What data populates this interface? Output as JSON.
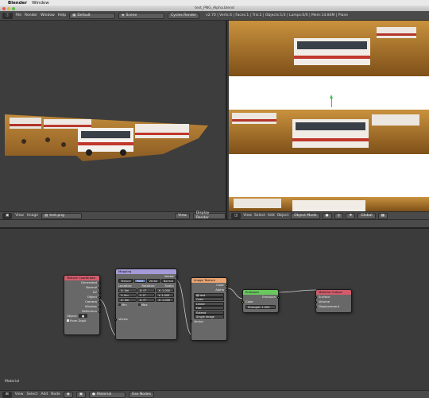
{
  "mac_menubar": {
    "app": "Blender",
    "window": "Window"
  },
  "window_title": "test_PNG_Alpha.blend",
  "info_header": {
    "menus": [
      "File",
      "Render",
      "Window",
      "Help"
    ],
    "layout": "Default",
    "scene": "Scene",
    "engine": "Cycles Render",
    "stats": "v2.70 | Verts:4 | Faces:1 | Tris:2 | Objects:1/3 | Lamps:0/0 | Mem:14.84M | Plane"
  },
  "view3d_header": {
    "menus": [
      "View",
      "Image"
    ],
    "image_name": "test.png",
    "view_label": "View",
    "mode": "Display Render"
  },
  "image_header": {
    "menus": [
      "View",
      "Select",
      "Add",
      "Object"
    ],
    "mode": "Object Mode",
    "orientation": "Global"
  },
  "node_editor": {
    "label": "Material",
    "header": {
      "menus": [
        "View",
        "Select",
        "Add",
        "Node"
      ],
      "material": "Material",
      "use_nodes": "Use Nodes"
    },
    "texcoord": {
      "title": "Texture Coordinate",
      "outputs": [
        "Generated",
        "Normal",
        "UV",
        "Object",
        "Camera",
        "Window",
        "Reflection"
      ],
      "object_label": "Object:",
      "from_dupli": "From Dupli"
    },
    "mapping": {
      "title": "Mapping",
      "vector_out": "Vector",
      "tabs": [
        "Texture",
        "Point",
        "Vector",
        "Normal"
      ],
      "cols": [
        "Location:",
        "Rotation:",
        "Scale:"
      ],
      "rows": [
        [
          "X: 0m",
          "X: 0°",
          "X: 1.000"
        ],
        [
          "Y: 0m",
          "Y: 0°",
          "Y: 1.000"
        ],
        [
          "Z: 0m",
          "Z: 0°",
          "Z: 1.000"
        ]
      ],
      "min": "Min",
      "max": "Max",
      "vector_in": "Vector"
    },
    "image_tex": {
      "title": "Image Texture",
      "outputs": [
        "Color",
        "Alpha"
      ],
      "image": "test",
      "options": [
        "Color",
        "Linear",
        "Flat",
        "Extend",
        "Single Image"
      ],
      "vector_in": "Vector"
    },
    "emission": {
      "title": "Emission",
      "output": "Emission",
      "inputs": [
        "Color",
        "Strength: 1.000"
      ]
    },
    "mat_output": {
      "title": "Material Output",
      "inputs": [
        "Surface",
        "Volume",
        "Displacement"
      ]
    }
  },
  "colors": {
    "tex_header": "#d35c6b",
    "mapping_header": "#a59ad8",
    "image_header": "#e8a471",
    "emission_header": "#69c75e",
    "output_header": "#d35c6b",
    "socket_yellow": "#e8d24a",
    "socket_blue": "#6a6ae8",
    "socket_green": "#44c85c"
  }
}
